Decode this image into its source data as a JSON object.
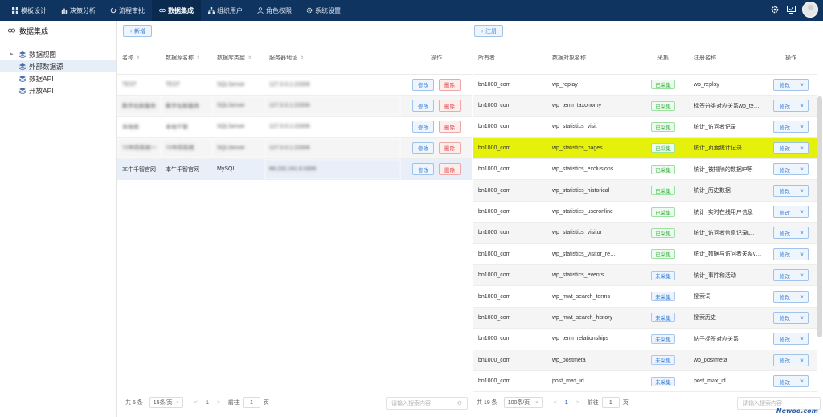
{
  "nav": [
    {
      "label": "模板设计",
      "icon": "grid-icon"
    },
    {
      "label": "决策分析",
      "icon": "bar-chart-icon"
    },
    {
      "label": "流程审批",
      "icon": "refresh-icon"
    },
    {
      "label": "数据集成",
      "icon": "link-icon",
      "active": true
    },
    {
      "label": "组织用户",
      "icon": "org-icon"
    },
    {
      "label": "角色权限",
      "icon": "user-icon"
    },
    {
      "label": "系统设置",
      "icon": "gear-icon"
    }
  ],
  "sidebar": {
    "title": "数据集成",
    "items": [
      {
        "label": "数据视图"
      },
      {
        "label": "外部数据源"
      },
      {
        "label": "数据API"
      },
      {
        "label": "开放API"
      }
    ]
  },
  "left": {
    "add_label": "+ 新增",
    "headers": [
      "名称",
      "数据源名称",
      "数据库类型",
      "服务器地址",
      "操作"
    ],
    "rows": [
      {
        "name": "TEST",
        "source": "TEST",
        "db": "SQLServer",
        "addr": "127.0.0.1:23306"
      },
      {
        "name": "数字化新服务",
        "source": "数字化新服务",
        "db": "SQLServer",
        "addr": "127.0.0.1:23306"
      },
      {
        "name": "本地库",
        "source": "本地千智",
        "db": "SQLServer",
        "addr": "127.0.0.1:23306"
      },
      {
        "name": "72年四系统一",
        "source": "72年四系统",
        "db": "SQLServer",
        "addr": "127.0.0.1:23306"
      },
      {
        "name": "本牛千智官网",
        "source": "本牛千智官网",
        "db": "MySQL",
        "addr": "88.232.241.6:3306"
      }
    ],
    "edit_label": "修改",
    "delete_label": "删除",
    "pager": {
      "total": "共 5 条",
      "size": "15条/页",
      "page": "1",
      "goto": "前往",
      "goto_value": "1",
      "unit": "页"
    },
    "search_placeholder": "请输入搜索内容"
  },
  "right": {
    "register_label": "+ 注册",
    "headers": [
      "所有者",
      "数据对象名称",
      "采集",
      "注册名称",
      "操作"
    ],
    "rows": [
      {
        "owner": "bn1000_com",
        "object": "wp_replay",
        "status": "已采集",
        "reg": "wp_replay"
      },
      {
        "owner": "bn1000_com",
        "object": "wp_term_taxonomy",
        "status": "已采集",
        "reg": "标签分类对应关系wp_te…"
      },
      {
        "owner": "bn1000_com",
        "object": "wp_statistics_visit",
        "status": "已采集",
        "reg": "统计_访问者记录"
      },
      {
        "owner": "bn1000_com",
        "object": "wp_statistics_pages",
        "status": "已采集",
        "reg": "统计_页面统计记录"
      },
      {
        "owner": "bn1000_com",
        "object": "wp_statistics_exclusions",
        "status": "已采集",
        "reg": "统计_被排除的数据IP等"
      },
      {
        "owner": "bn1000_com",
        "object": "wp_statistics_historical",
        "status": "已采集",
        "reg": "统计_历史数据"
      },
      {
        "owner": "bn1000_com",
        "object": "wp_statistics_useronline",
        "status": "已采集",
        "reg": "统计_实时在线用户信息"
      },
      {
        "owner": "bn1000_com",
        "object": "wp_statistics_visitor",
        "status": "已采集",
        "reg": "统计_访问者信息记录L…"
      },
      {
        "owner": "bn1000_com",
        "object": "wp_statistics_visitor_re…",
        "status": "已采集",
        "reg": "统计_数据与访问者关系v…"
      },
      {
        "owner": "bn1000_com",
        "object": "wp_statistics_events",
        "status": "未采集",
        "reg": "统计_事件和活动"
      },
      {
        "owner": "bn1000_com",
        "object": "wp_mwt_search_terms",
        "status": "未采集",
        "reg": "搜索词"
      },
      {
        "owner": "bn1000_com",
        "object": "wp_mwt_search_history",
        "status": "未采集",
        "reg": "搜索历史"
      },
      {
        "owner": "bn1000_com",
        "object": "wp_term_relationships",
        "status": "未采集",
        "reg": "帖子标签对应关系"
      },
      {
        "owner": "bn1000_com",
        "object": "wp_postmeta",
        "status": "未采集",
        "reg": "wp_postmeta"
      },
      {
        "owner": "bn1000_com",
        "object": "post_max_id",
        "status": "未采集",
        "reg": "post_max_id"
      }
    ],
    "edit_label": "修改",
    "dropdown_glyph": "∨",
    "pager": {
      "total": "共 19 条",
      "size": "100条/页",
      "page": "1",
      "goto": "前往",
      "goto_value": "1",
      "unit": "页"
    },
    "search_placeholder": "请输入搜索内容"
  },
  "watermark": "Newoo.com",
  "colors": {
    "topbar": "#0f3460",
    "highlight": "#e5f10a",
    "accent": "#3a7fd5",
    "collected": "#3bb54a",
    "danger": "#e04c4c"
  }
}
